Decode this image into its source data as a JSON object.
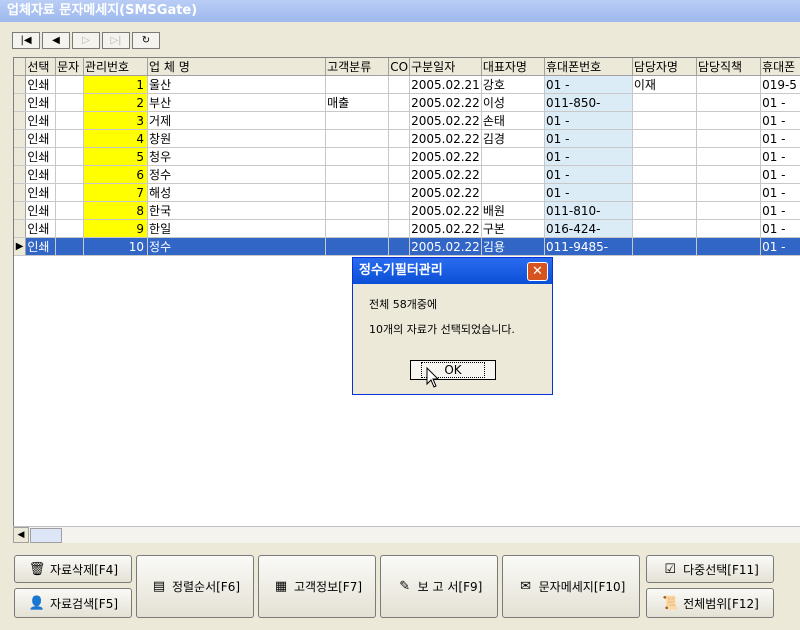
{
  "window": {
    "title": "업체자료 문자메세지(SMSGate)"
  },
  "nav": {
    "first_icon": "first-record-icon",
    "prev_icon": "prev-record-icon",
    "next_icon": "next-record-icon",
    "last_icon": "last-record-icon",
    "refresh_icon": "refresh-icon"
  },
  "grid": {
    "columns": [
      "선택",
      "문자",
      "관리번호",
      "업 체 명",
      "고객분류",
      "CO",
      "구분일자",
      "대표자명",
      "휴대폰번호",
      "담당자명",
      "담당직책",
      "휴대폰"
    ],
    "rows": [
      {
        "sel": "인쇄",
        "msg": "",
        "no": "1",
        "name": "울산",
        "cls": "",
        "co": "",
        "date": "2005.02.21",
        "rep": "강호",
        "phone": "01 -",
        "mgr": "이재",
        "pos": "",
        "phone2": "019-5"
      },
      {
        "sel": "인쇄",
        "msg": "",
        "no": "2",
        "name": "부산",
        "cls": "매출",
        "co": "",
        "date": "2005.02.22",
        "rep": "이성",
        "phone": "011-850-",
        "mgr": "",
        "pos": "",
        "phone2": "01 -"
      },
      {
        "sel": "인쇄",
        "msg": "",
        "no": "3",
        "name": "거제",
        "cls": "",
        "co": "",
        "date": "2005.02.22",
        "rep": "손태",
        "phone": "01 -",
        "mgr": "",
        "pos": "",
        "phone2": "01 -"
      },
      {
        "sel": "인쇄",
        "msg": "",
        "no": "4",
        "name": "창원",
        "cls": "",
        "co": "",
        "date": "2005.02.22",
        "rep": "김경",
        "phone": "01 -",
        "mgr": "",
        "pos": "",
        "phone2": "01 -"
      },
      {
        "sel": "인쇄",
        "msg": "",
        "no": "5",
        "name": "청우",
        "cls": "",
        "co": "",
        "date": "2005.02.22",
        "rep": "",
        "phone": "01 -",
        "mgr": "",
        "pos": "",
        "phone2": "01 -"
      },
      {
        "sel": "인쇄",
        "msg": "",
        "no": "6",
        "name": "정수",
        "cls": "",
        "co": "",
        "date": "2005.02.22",
        "rep": "",
        "phone": "01 -",
        "mgr": "",
        "pos": "",
        "phone2": "01 -"
      },
      {
        "sel": "인쇄",
        "msg": "",
        "no": "7",
        "name": "해성",
        "cls": "",
        "co": "",
        "date": "2005.02.22",
        "rep": "",
        "phone": "01 -",
        "mgr": "",
        "pos": "",
        "phone2": "01 -"
      },
      {
        "sel": "인쇄",
        "msg": "",
        "no": "8",
        "name": "한국",
        "cls": "",
        "co": "",
        "date": "2005.02.22",
        "rep": "배원",
        "phone": "011-810-",
        "mgr": "",
        "pos": "",
        "phone2": "01 -"
      },
      {
        "sel": "인쇄",
        "msg": "",
        "no": "9",
        "name": "한일",
        "cls": "",
        "co": "",
        "date": "2005.02.22",
        "rep": "구본",
        "phone": "016-424-",
        "mgr": "",
        "pos": "",
        "phone2": "01 -"
      },
      {
        "sel": "인쇄",
        "msg": "",
        "no": "10",
        "name": "정수",
        "cls": "",
        "co": "",
        "date": "2005.02.22",
        "rep": "김용",
        "phone": "011-9485-",
        "mgr": "",
        "pos": "",
        "phone2": "01 -"
      }
    ],
    "selected_row": 9
  },
  "dialog": {
    "title": "정수기필터관리",
    "line1": "전체 58개중에",
    "line2": "10개의 자료가 선택되었습니다.",
    "ok_label": "OK"
  },
  "buttons": {
    "delete": "자료삭제[F4]",
    "search": "자료검색[F5]",
    "sort": "정렬순서[F6]",
    "customer": "고객정보[F7]",
    "report": "보 고 서[F9]",
    "sms": "문자메세지[F10]",
    "multi": "다중선택[F11]",
    "range": "전체범위[F12]"
  },
  "colors": {
    "selected_row": "#3165c6",
    "id_column": "#ffff00",
    "phone_column": "#dcecf7",
    "dialog_title": "#0a4fd6"
  }
}
